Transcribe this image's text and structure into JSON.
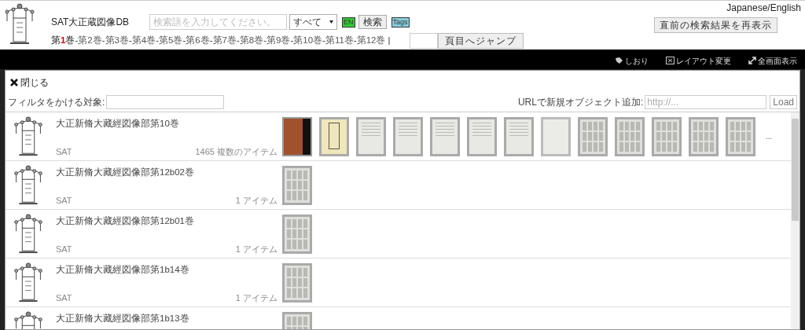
{
  "header": {
    "title": "SAT大正蔵図像DB",
    "search": {
      "placeholder": "検索語を入力してください。"
    },
    "scope": "すべて",
    "en_badge": "EN",
    "search_button": "検索",
    "tags_badge": "Tags",
    "language": "Japanese/English",
    "redisplay_button": "直前の検索結果を再表示",
    "jump_button": "頁目へジャンプ",
    "separator": "|",
    "volumes": [
      {
        "label": "第**1**巻",
        "selected": true
      },
      {
        "sep": "-",
        "label": "第2巻",
        "selected": false
      },
      {
        "sep": "-",
        "label": "第3巻",
        "selected": false
      },
      {
        "sep": "-",
        "label": "第4巻",
        "selected": false
      },
      {
        "sep": "-",
        "label": "第5巻",
        "selected": false
      },
      {
        "sep": "-",
        "label": "第6巻",
        "selected": false
      },
      {
        "sep": "-",
        "label": "第7巻",
        "selected": false
      },
      {
        "sep": "-",
        "label": "第8巻",
        "selected": false
      },
      {
        "sep": "-",
        "label": "第9巻",
        "selected": false
      },
      {
        "sep": "-",
        "label": "第10巻",
        "selected": false
      },
      {
        "sep": "-",
        "label": "第11巻",
        "selected": false
      },
      {
        "sep": "-",
        "label": "第12巻",
        "selected": false
      }
    ]
  },
  "toolbar": [
    "しおり",
    "レイアウト変更",
    "全画面表示"
  ],
  "panel": {
    "close": "閉じる",
    "filter_label": "フィルタをかける対象:",
    "url_label": "URLで新規オブジェクト追加:",
    "url_placeholder": "http://...",
    "load_button": "Load",
    "rows": [
      {
        "title": "大正新脩大藏經図像部第10巻",
        "source": "SAT",
        "count": "1465 複数のアイテム",
        "more": "...",
        "thumbs": [
          {
            "kind": "cover"
          },
          {
            "kind": "title"
          },
          {
            "kind": "page"
          },
          {
            "kind": "page"
          },
          {
            "kind": "page"
          },
          {
            "kind": "page"
          },
          {
            "kind": "page"
          },
          {
            "kind": "blank"
          },
          {
            "kind": "dense"
          },
          {
            "kind": "dense"
          },
          {
            "kind": "dense"
          },
          {
            "kind": "dense"
          },
          {
            "kind": "dense"
          }
        ]
      },
      {
        "title": "大正新脩大藏經図像部第12b02巻",
        "source": "SAT",
        "count": "1 アイテム",
        "thumbs": [
          {
            "kind": "dense"
          }
        ]
      },
      {
        "title": "大正新脩大藏經図像部第12b01巻",
        "source": "SAT",
        "count": "1 アイテム",
        "thumbs": [
          {
            "kind": "dense"
          }
        ]
      },
      {
        "title": "大正新脩大藏經図像部第1b14巻",
        "source": "SAT",
        "count": "1 アイテム",
        "thumbs": [
          {
            "kind": "dense"
          }
        ]
      },
      {
        "title": "大正新脩大藏經図像部第1b13巻",
        "thumbs": [
          {
            "kind": "dense"
          }
        ]
      }
    ]
  }
}
